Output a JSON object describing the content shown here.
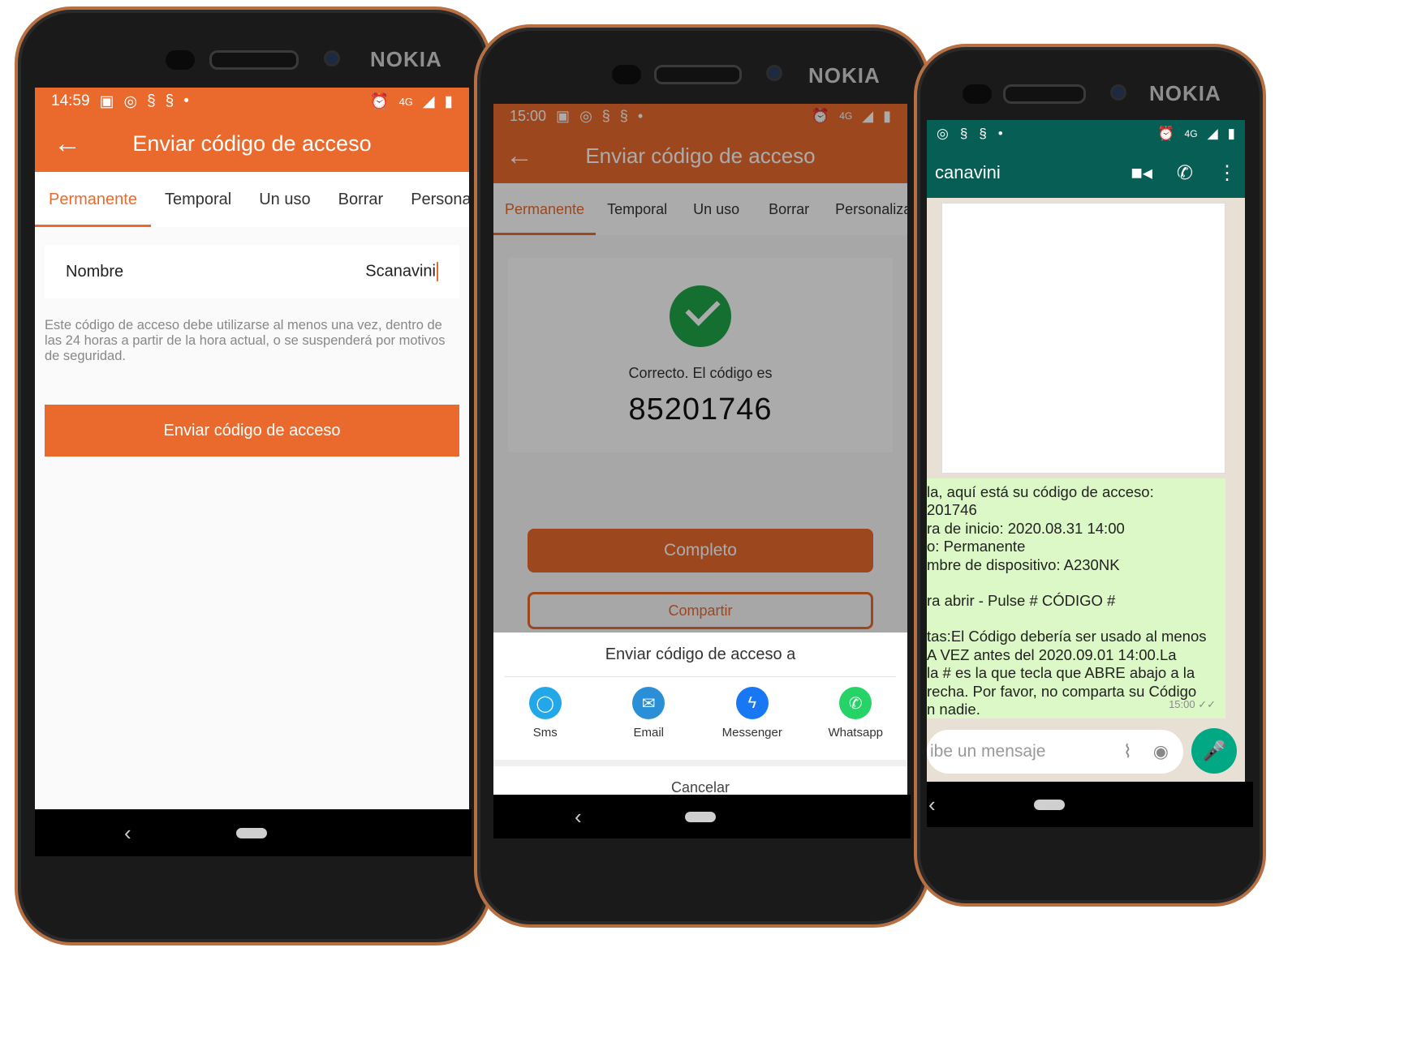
{
  "brand": "NOKIA",
  "colors": {
    "accent": "#ea6a2e",
    "whatsapp_green": "#075e54",
    "success": "#1fa64a"
  },
  "phone1": {
    "time": "14:59",
    "network": "4G",
    "title": "Enviar código de acceso",
    "tabs": [
      "Permanente",
      "Temporal",
      "Un uso",
      "Borrar",
      "Personaliza"
    ],
    "name_label": "Nombre",
    "name_value": "Scanavini",
    "notice": "Este código de acceso debe utilizarse al menos una vez, dentro de las 24 horas a partir de la hora actual, o se suspenderá por motivos de seguridad.",
    "send_button": "Enviar código de acceso"
  },
  "phone2": {
    "time": "15:00",
    "network": "4G",
    "title": "Enviar código de acceso",
    "tabs": [
      "Permanente",
      "Temporal",
      "Un uso",
      "Borrar",
      "Personaliza"
    ],
    "success_text": "Correcto. El código es",
    "code": "85201746",
    "complete_button": "Completo",
    "secondary_button": "Compartir",
    "sheet_title": "Enviar código de acceso a",
    "share_options": [
      {
        "label": "Sms",
        "icon": "sms-icon",
        "color": "#22a7e8"
      },
      {
        "label": "Email",
        "icon": "email-icon",
        "color": "#2a8fd6"
      },
      {
        "label": "Messenger",
        "icon": "messenger-icon",
        "color": "#1877f2"
      },
      {
        "label": "Whatsapp",
        "icon": "whatsapp-icon",
        "color": "#25d366"
      }
    ],
    "cancel": "Cancelar"
  },
  "phone3": {
    "network": "4G",
    "contact": "canavini",
    "message_lines": [
      "la, aquí está su código de acceso:",
      "201746",
      "ra de inicio: 2020.08.31 14:00",
      "o: Permanente",
      "mbre de dispositivo: A230NK",
      "",
      "ra abrir - Pulse # CÓDIGO #",
      "",
      "tas:El Código debería ser usado al menos",
      "A VEZ antes del 2020.09.01 14:00.La",
      "la # es la que tecla que ABRE abajo a la",
      "recha. Por favor, no comparta su Código",
      "n nadie."
    ],
    "message_time": "15:00 ✓✓",
    "input_placeholder": "ibe un mensaje"
  }
}
